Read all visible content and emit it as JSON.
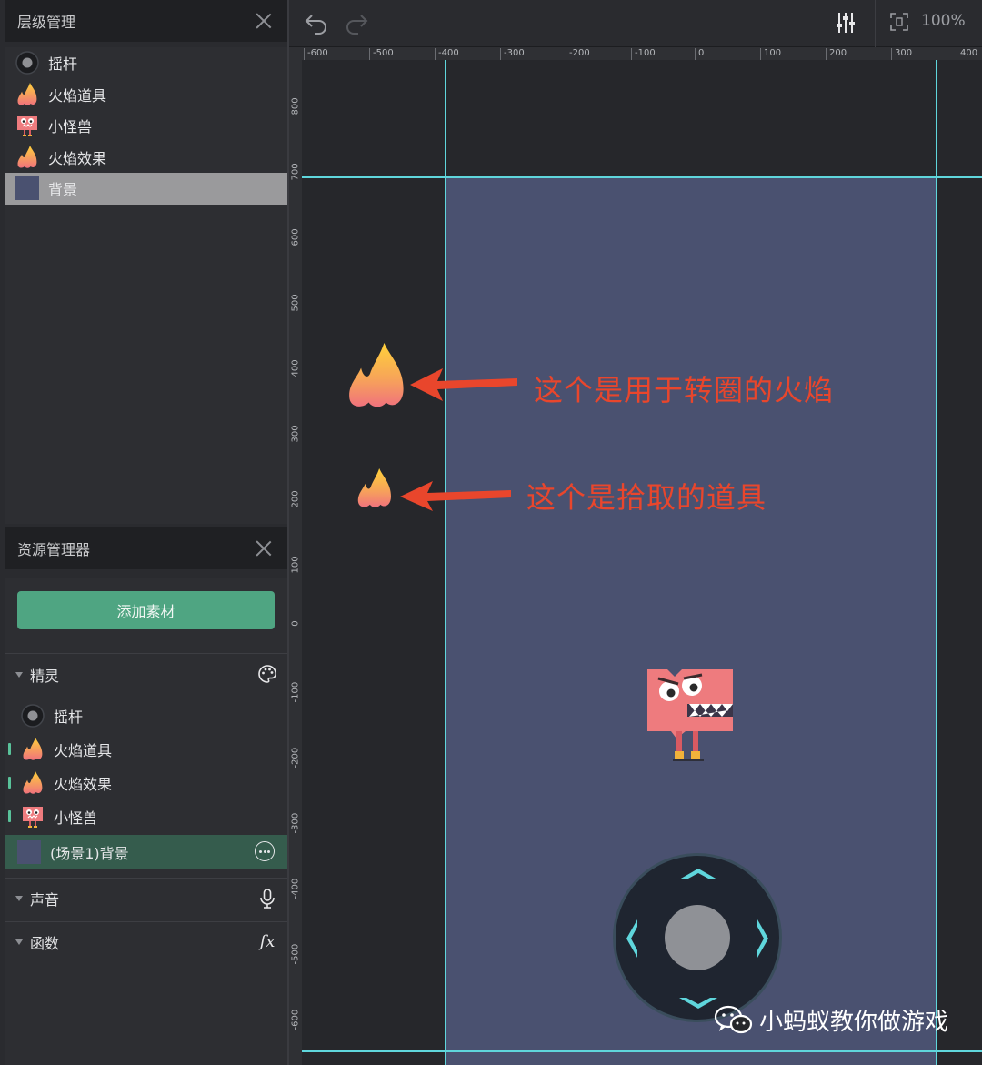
{
  "layer_panel": {
    "title": "层级管理",
    "items": [
      {
        "label": "摇杆",
        "icon": "joystick-icon"
      },
      {
        "label": "火焰道具",
        "icon": "flame-icon"
      },
      {
        "label": "小怪兽",
        "icon": "monster-icon"
      },
      {
        "label": "火焰效果",
        "icon": "flame-icon"
      },
      {
        "label": "背景",
        "icon": "background-icon",
        "selected": true
      }
    ]
  },
  "asset_panel": {
    "title": "资源管理器",
    "add_button": "添加素材",
    "sections": {
      "sprites": "精灵",
      "sound": "声音",
      "functions": "函数"
    },
    "function_icon": "fx",
    "sprites": [
      {
        "label": "摇杆",
        "icon": "joystick-icon",
        "marked": false
      },
      {
        "label": "火焰道具",
        "icon": "flame-icon",
        "marked": true
      },
      {
        "label": "火焰效果",
        "icon": "flame-icon",
        "marked": true
      },
      {
        "label": "小怪兽",
        "icon": "monster-icon",
        "marked": true
      },
      {
        "label": "(场景1)背景",
        "icon": "background-icon",
        "selected": true
      }
    ]
  },
  "toolbar": {
    "zoom": "100%"
  },
  "rulers": {
    "horizontal": [
      "-600",
      "-500",
      "-400",
      "-300",
      "-200",
      "-100",
      "0",
      "100",
      "200",
      "300",
      "400"
    ],
    "vertical": [
      "800",
      "700",
      "600",
      "500",
      "400",
      "300",
      "200",
      "100",
      "0",
      "-100",
      "-200",
      "-300",
      "-400",
      "-500",
      "-600"
    ]
  },
  "annotations": {
    "spin_flame": "这个是用于转圈的火焰",
    "pickup_item": "这个是拾取的道具",
    "arrow_color": "#e9462c"
  },
  "watermark": "小蚂蚁教你做游戏",
  "colors": {
    "accent_green": "#4fa582",
    "guide_cyan": "#5fd6dc",
    "stage": "#4a5170",
    "monster": "#ee7b7e"
  }
}
